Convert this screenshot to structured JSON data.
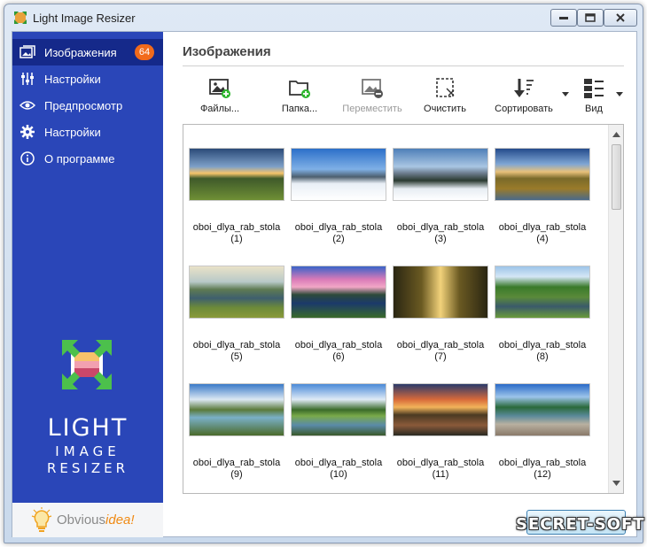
{
  "window": {
    "title": "Light Image Resizer"
  },
  "sidebar": {
    "items": [
      {
        "label": "Изображения",
        "icon": "images-icon",
        "badge": "64",
        "active": true
      },
      {
        "label": "Настройки",
        "icon": "sliders-icon"
      },
      {
        "label": "Предпросмотр",
        "icon": "eye-icon"
      },
      {
        "label": "Настройки",
        "icon": "gear-icon"
      },
      {
        "label": "О программе",
        "icon": "info-icon"
      }
    ],
    "logo": {
      "line1": "LIGHT",
      "line2": "IMAGE",
      "line3": "RESIZER"
    },
    "brand": {
      "part1": "Obvious",
      "part2": "idea!"
    }
  },
  "main": {
    "title": "Изображения",
    "toolbar": [
      {
        "label": "Файлы...",
        "icon": "add-file-icon"
      },
      {
        "label": "Папка...",
        "icon": "add-folder-icon"
      },
      {
        "label": "Переместить",
        "icon": "remove-image-icon",
        "disabled": true
      },
      {
        "label": "Очистить",
        "icon": "clear-icon"
      },
      {
        "label": "Сортировать",
        "icon": "sort-icon"
      },
      {
        "label": "Вид",
        "icon": "view-icon"
      }
    ],
    "thumbnails": [
      {
        "name": "oboi_dlya_rab_stola",
        "index": "(1)"
      },
      {
        "name": "oboi_dlya_rab_stola",
        "index": "(2)"
      },
      {
        "name": "oboi_dlya_rab_stola",
        "index": "(3)"
      },
      {
        "name": "oboi_dlya_rab_stola",
        "index": "(4)"
      },
      {
        "name": "oboi_dlya_rab_stola",
        "index": "(5)"
      },
      {
        "name": "oboi_dlya_rab_stola",
        "index": "(6)"
      },
      {
        "name": "oboi_dlya_rab_stola",
        "index": "(7)"
      },
      {
        "name": "oboi_dlya_rab_stola",
        "index": "(8)"
      },
      {
        "name": "oboi_dlya_rab_stola",
        "index": "(9)"
      },
      {
        "name": "oboi_dlya_rab_stola",
        "index": "(10)"
      },
      {
        "name": "oboi_dlya_rab_stola",
        "index": "(11)"
      },
      {
        "name": "oboi_dlya_rab_stola",
        "index": "(12)"
      }
    ]
  },
  "watermark": "SECRET-SOFT",
  "colors": {
    "sidebar": "#2a46b8",
    "sidebar_active": "#15298a",
    "badge": "#f26a1b",
    "add_green": "#2fb62f"
  }
}
